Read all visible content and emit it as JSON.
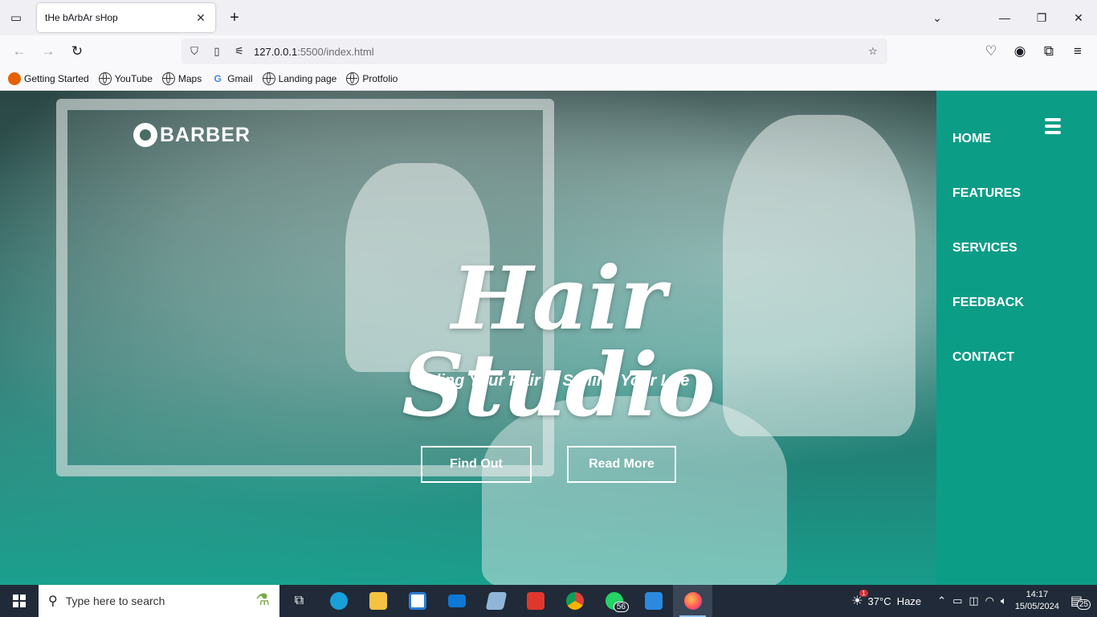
{
  "browser": {
    "tab_title": "tHe bArbAr sHop",
    "url_host": "127.0.0.1",
    "url_rest": ":5500/index.html",
    "bookmarks": [
      "Getting Started",
      "YouTube",
      "Maps",
      "Gmail",
      "Landing page",
      "Protfolio"
    ]
  },
  "site": {
    "logo": "BARBER",
    "hero_title": "Hair Studio",
    "hero_subtitle": "Styling Your Hair Is Styling Your Life",
    "buttons": {
      "find_out": "Find Out",
      "read_more": "Read More"
    },
    "nav": [
      "HOME",
      "FEATURES",
      "SERVICES",
      "FEEDBACK",
      "CONTACT"
    ],
    "colors": {
      "sidebar": "#0c9d87",
      "accent": "#14aa96"
    }
  },
  "taskbar": {
    "search_placeholder": "Type here to search",
    "whatsapp_badge": "56",
    "weather": "37°C  Haze",
    "weather_alert": "1",
    "time": "14:17",
    "date": "15/05/2024",
    "notifications": "25"
  }
}
